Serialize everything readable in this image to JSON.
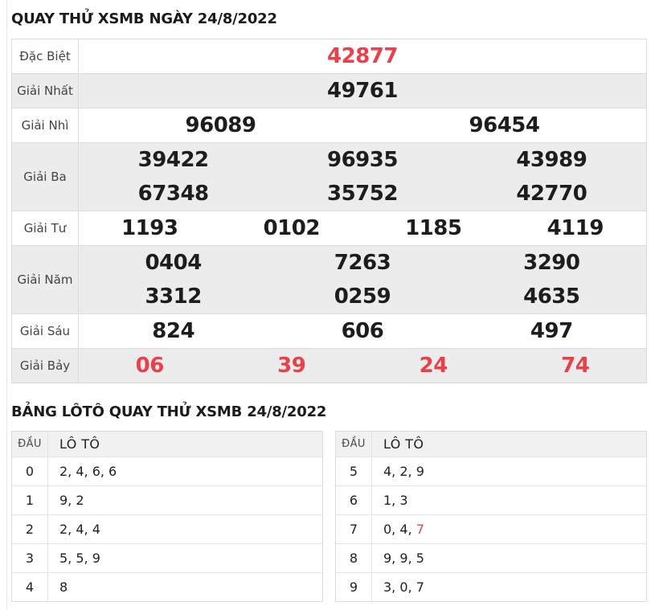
{
  "colors": {
    "accent_red": "#e8414a",
    "row_shade": "#ececec",
    "header_shade": "#f1f1f1",
    "border": "#dcdcdc"
  },
  "page": {
    "results_title": "QUAY THỬ XSMB NGÀY 24/8/2022",
    "loto_title": "BẢNG LÔTÔ QUAY THỬ XSMB 24/8/2022"
  },
  "results": {
    "rows": [
      {
        "label": "Đặc Biệt",
        "highlight": "red",
        "lines": [
          [
            "42877"
          ]
        ]
      },
      {
        "label": "Giải Nhất",
        "highlight": "none",
        "lines": [
          [
            "49761"
          ]
        ]
      },
      {
        "label": "Giải Nhì",
        "highlight": "none",
        "lines": [
          [
            "96089",
            "96454"
          ]
        ]
      },
      {
        "label": "Giải Ba",
        "highlight": "none",
        "lines": [
          [
            "39422",
            "96935",
            "43989"
          ],
          [
            "67348",
            "35752",
            "42770"
          ]
        ]
      },
      {
        "label": "Giải Tư",
        "highlight": "none",
        "lines": [
          [
            "1193",
            "0102",
            "1185",
            "4119"
          ]
        ]
      },
      {
        "label": "Giải Năm",
        "highlight": "none",
        "lines": [
          [
            "0404",
            "7263",
            "3290"
          ],
          [
            "3312",
            "0259",
            "4635"
          ]
        ]
      },
      {
        "label": "Giải Sáu",
        "highlight": "none",
        "lines": [
          [
            "824",
            "606",
            "497"
          ]
        ]
      },
      {
        "label": "Giải Bảy",
        "highlight": "red",
        "lines": [
          [
            "06",
            "39",
            "24",
            "74"
          ]
        ]
      }
    ]
  },
  "loto": {
    "header": {
      "dau": "ĐẦU",
      "loto": "LÔ TÔ"
    },
    "left": [
      {
        "dau": "0",
        "plain": "2, 4, 6, 6",
        "red": ""
      },
      {
        "dau": "1",
        "plain": "9, 2",
        "red": ""
      },
      {
        "dau": "2",
        "plain": "2, 4, 4",
        "red": ""
      },
      {
        "dau": "3",
        "plain": "5, 5, 9",
        "red": ""
      },
      {
        "dau": "4",
        "plain": "8",
        "red": ""
      }
    ],
    "right": [
      {
        "dau": "5",
        "plain": "4, 2, 9",
        "red": ""
      },
      {
        "dau": "6",
        "plain": "1, 3",
        "red": ""
      },
      {
        "dau": "7",
        "plain": "0, 4, ",
        "red": "7"
      },
      {
        "dau": "8",
        "plain": "9, 9, 5",
        "red": ""
      },
      {
        "dau": "9",
        "plain": "3, 0, 7",
        "red": ""
      }
    ]
  }
}
